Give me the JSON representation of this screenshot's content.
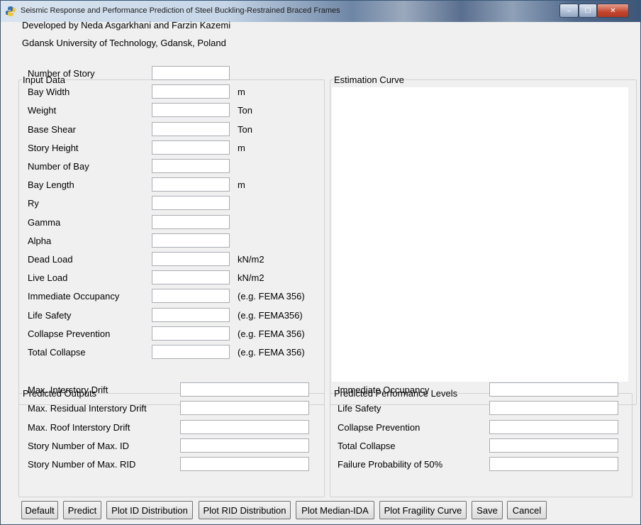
{
  "window": {
    "title": "Seismic Response and Performance Prediction of Steel Buckling-Restrained Braced Frames",
    "minimize_glyph": "–",
    "maximize_glyph": "☐",
    "close_glyph": "✕"
  },
  "header": {
    "developers": "Developed by Neda Asgarkhani and Farzin Kazemi",
    "affiliation": "Gdansk University of Technology, Gdansk, Poland"
  },
  "input_data": {
    "legend": "Input Data",
    "fields": [
      {
        "label": "Number of Story",
        "unit": "",
        "value": ""
      },
      {
        "label": "Bay Width",
        "unit": "m",
        "value": ""
      },
      {
        "label": "Weight",
        "unit": "Ton",
        "value": ""
      },
      {
        "label": "Base Shear",
        "unit": "Ton",
        "value": ""
      },
      {
        "label": "Story Height",
        "unit": "m",
        "value": ""
      },
      {
        "label": "Number of Bay",
        "unit": "",
        "value": ""
      },
      {
        "label": "Bay Length",
        "unit": "m",
        "value": ""
      },
      {
        "label": "Ry",
        "unit": "",
        "value": ""
      },
      {
        "label": "Gamma",
        "unit": "",
        "value": ""
      },
      {
        "label": "Alpha",
        "unit": "",
        "value": ""
      },
      {
        "label": "Dead Load",
        "unit": "kN/m2",
        "value": ""
      },
      {
        "label": "Live Load",
        "unit": "kN/m2",
        "value": ""
      },
      {
        "label": "Immediate Occupancy",
        "unit": "(e.g. FEMA 356)",
        "value": ""
      },
      {
        "label": "Life Safety",
        "unit": "(e.g. FEMA356)",
        "value": ""
      },
      {
        "label": "Collapse Prevention",
        "unit": "(e.g. FEMA 356)",
        "value": ""
      },
      {
        "label": "Total Collapse",
        "unit": "(e.g. FEMA 356)",
        "value": ""
      }
    ]
  },
  "estimation_curve": {
    "legend": "Estimation Curve"
  },
  "predicted_outputs": {
    "legend": "Predicted Outputs",
    "fields": [
      {
        "label": "Max. Interstory Drift",
        "value": ""
      },
      {
        "label": "Max. Residual Interstory Drift",
        "value": ""
      },
      {
        "label": "Max. Roof Interstory Drift",
        "value": ""
      },
      {
        "label": "Story Number of Max. ID",
        "value": ""
      },
      {
        "label": "Story Number of Max. RID",
        "value": ""
      }
    ]
  },
  "predicted_levels": {
    "legend": "Predicted Performance Levels",
    "fields": [
      {
        "label": "Immediate Occupancy",
        "value": ""
      },
      {
        "label": "Life Safety",
        "value": ""
      },
      {
        "label": "Collapse Prevention",
        "value": ""
      },
      {
        "label": "Total Collapse",
        "value": ""
      },
      {
        "label": "Failure Probability of 50%",
        "value": ""
      }
    ]
  },
  "buttons": {
    "default": "Default",
    "predict": "Predict",
    "plot_id": "Plot ID Distribution",
    "plot_rid": "Plot RID Distribution",
    "plot_median_ida": "Plot Median-IDA",
    "plot_fragility": "Plot Fragility Curve",
    "save": "Save",
    "cancel": "Cancel"
  }
}
